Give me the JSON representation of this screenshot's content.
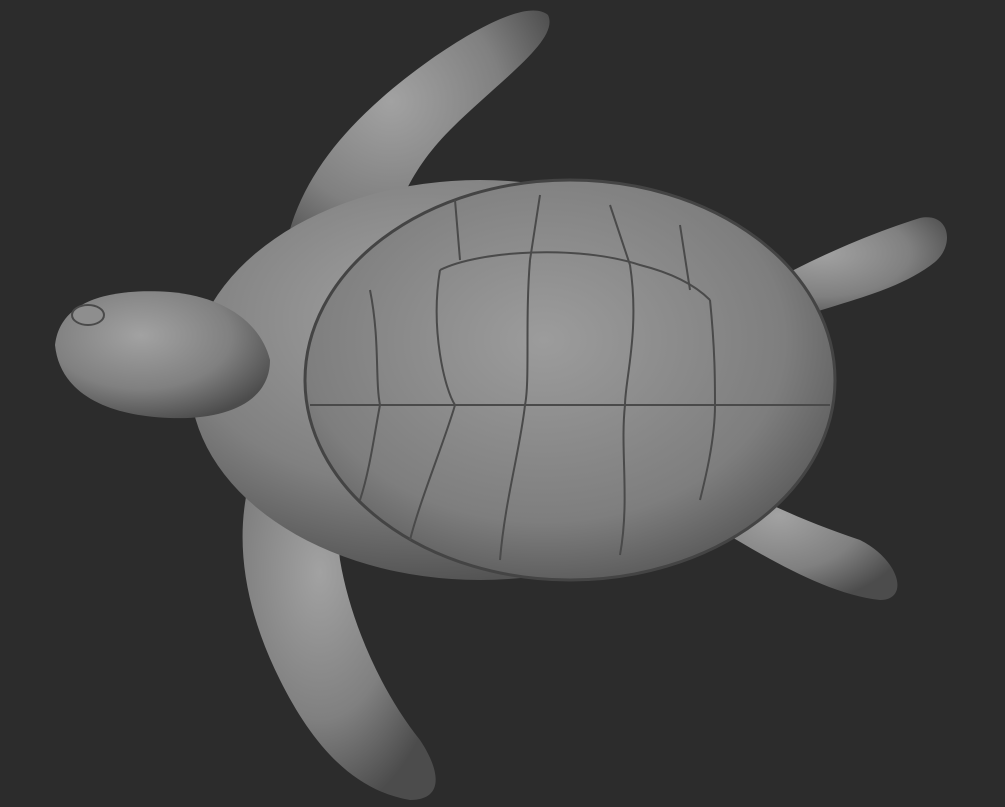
{
  "scene": {
    "subject": "sea-turtle-sculpt",
    "colors": {
      "background": "#2c2c2c",
      "skin_light": "#9a9a9a",
      "skin_mid": "#7c7c7c",
      "skin_dark": "#4a4a4a",
      "seam": "#3e3e3e"
    }
  }
}
